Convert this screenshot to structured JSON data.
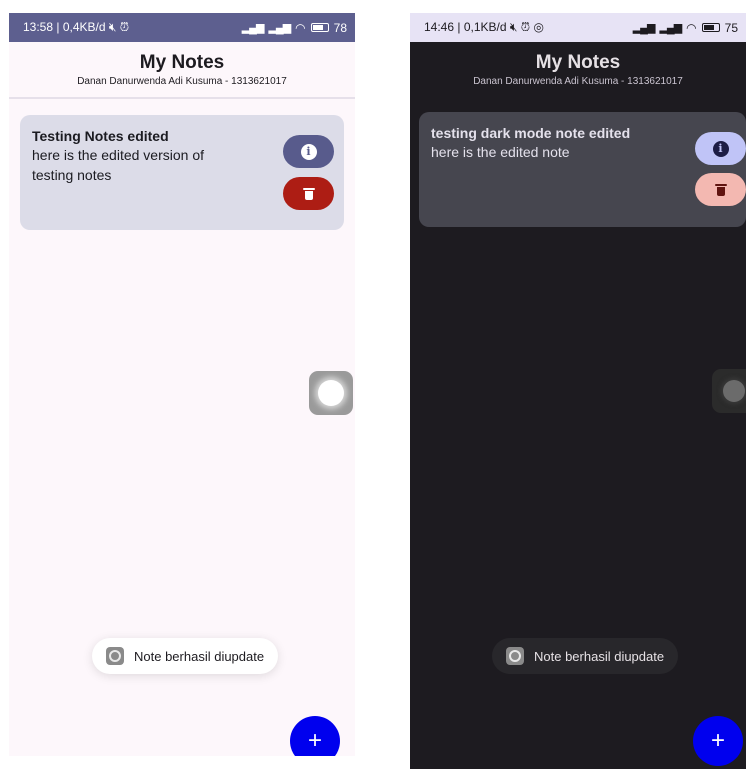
{
  "light": {
    "status": {
      "time": "13:58 | 0,4KB/d",
      "battery": "78",
      "battery_level": 0.78
    },
    "app": {
      "title": "My Notes",
      "subtitle": "Danan Danurwenda Adi Kusuma - 1313621017"
    },
    "notes": [
      {
        "title": "Testing Notes edited",
        "body": "here is the edited version of testing notes"
      }
    ],
    "toast": "Note berhasil diupdate",
    "fab": "+"
  },
  "dark": {
    "status": {
      "time": "14:46 | 0,1KB/d",
      "battery": "75",
      "battery_level": 0.75
    },
    "app": {
      "title": "My Notes",
      "subtitle": "Danan Danurwenda Adi Kusuma - 1313621017"
    },
    "notes": [
      {
        "title": "testing dark mode note edited",
        "body": "here is the edited note"
      }
    ],
    "toast": "Note berhasil diupdate",
    "fab": "+"
  },
  "icons": {
    "info": "info-icon",
    "delete": "trash-icon",
    "add": "plus-icon",
    "alarm": "alarm-icon",
    "wifi": "wifi-icon",
    "signal": "signal-icon"
  },
  "colors": {
    "light_status": "#5d5f8f",
    "light_card": "#dcdce8",
    "info_button_light": "#585b8c",
    "delete_button_light": "#ad1d14",
    "dark_bg": "#1d1b20",
    "dark_card": "#46464f",
    "info_button_dark": "#c0c4f7",
    "delete_button_dark": "#f3b8b1",
    "fab": "#0000ee"
  }
}
